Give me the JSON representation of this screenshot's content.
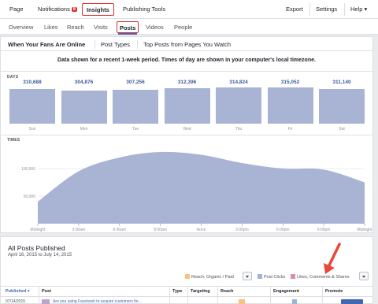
{
  "topnav": {
    "page": "Page",
    "notifications": "Notifications",
    "notifications_badge": "8",
    "insights": "Insights",
    "publishing_tools": "Publishing Tools",
    "export": "Export",
    "settings": "Settings",
    "help": "Help"
  },
  "subnav": {
    "tabs": [
      "Overview",
      "Likes",
      "Reach",
      "Visits",
      "Posts",
      "Videos",
      "People"
    ],
    "selected": "Posts"
  },
  "panel": {
    "tabs": [
      "When Your Fans Are Online",
      "Post Types",
      "Top Posts from Pages You Watch"
    ],
    "notice": "Data shown for a recent 1-week period. Times of day are shown in your computer's local timezone.",
    "days_label": "DAYS",
    "times_label": "TIMES"
  },
  "chart_data": [
    {
      "type": "bar",
      "title": "DAYS",
      "categories": [
        "Sun",
        "Mon",
        "Tue",
        "Wed",
        "Thu",
        "Fri",
        "Sat"
      ],
      "values": [
        310688,
        304876,
        307256,
        312396,
        314824,
        315052,
        311140
      ],
      "value_labels": [
        "310,688",
        "304,876",
        "307,256",
        "312,396",
        "314,824",
        "315,052",
        "311,140"
      ]
    },
    {
      "type": "area",
      "title": "TIMES",
      "x": [
        "Midnight",
        "3:00am",
        "6:00am",
        "9:00am",
        "Noon",
        "3:00pm",
        "6:00pm",
        "9:00pm",
        "Midnight"
      ],
      "y": [
        40000,
        95000,
        120000,
        130000,
        125000,
        110000,
        100000,
        98000,
        75000
      ],
      "yticks": [
        "50,000",
        "100,000"
      ],
      "ylim": [
        0,
        140000
      ]
    }
  ],
  "posts": {
    "title": "All Posts Published",
    "range": "April 16, 2015 to July 14, 2015",
    "legend": [
      {
        "label": "Reach: Organic / Paid",
        "color": "#f7c181"
      },
      {
        "label": "Post Clicks",
        "color": "#9cb4d8"
      },
      {
        "label": "Likes, Comments & Shares",
        "color": "#d98fa4"
      }
    ],
    "columns": [
      "Published",
      "Post",
      "Type",
      "Targeting",
      "Reach",
      "Engagement",
      "Promote"
    ],
    "row": {
      "published": "07/14/2015",
      "post": "Are you using Facebook to acquire customers for..."
    }
  },
  "colors": {
    "accent": "#4267b2",
    "highlight": "#e02b2b",
    "bar": "#a9b4d4",
    "arrow": "#e8473a"
  }
}
